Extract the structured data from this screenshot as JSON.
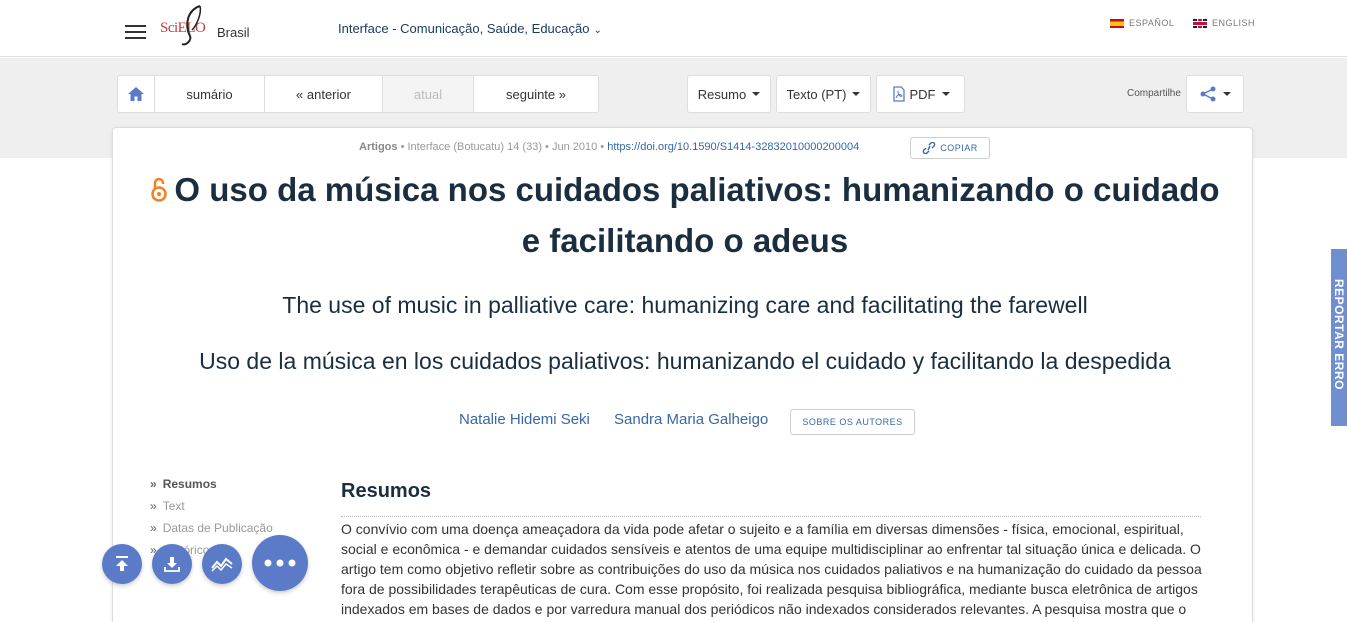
{
  "header": {
    "logo_brand": "SciELO",
    "logo_country": "Brasil",
    "journal": "Interface - Comunicação, Saúde, Educação",
    "languages": [
      {
        "code": "es",
        "label": "ESPAÑOL"
      },
      {
        "code": "en",
        "label": "ENGLISH"
      }
    ]
  },
  "toolbar": {
    "nav": {
      "sumario": "sumário",
      "anterior": "« anterior",
      "atual": "atual",
      "seguinte": "seguinte »"
    },
    "resumo": "Resumo",
    "texto": "Texto (PT)",
    "pdf": "PDF",
    "share_label": "Compartilhe"
  },
  "article": {
    "meta": {
      "category": "Artigos",
      "source": "Interface (Botucatu) 14 (33) • Jun 2010 •",
      "doi": "https://doi.org/10.1590/S1414-32832010000200004",
      "copy_label": "COPIAR"
    },
    "title": "O uso da música nos cuidados paliativos: humanizando o cuidado e facilitando o adeus",
    "title_en": "The use of music in palliative care: humanizing care and facilitating the farewell",
    "title_es": "Uso de la música en los cuidados paliativos: humanizando el cuidado y facilitando la despedida",
    "authors": [
      "Natalie Hidemi Seki",
      "Sandra Maria Galheigo"
    ],
    "about_authors_label": "SOBRE OS AUTORES"
  },
  "sidenav": {
    "items": [
      "Resumos",
      "Text",
      "Datas de Publicação",
      "Histórico"
    ]
  },
  "section": {
    "title": "Resumos",
    "abstract": "O convívio com uma doença ameaçadora da vida pode afetar o sujeito e a família em diversas dimensões - física, emocional, espiritual, social e econômica - e demandar cuidados sensíveis e atentos de uma equipe multidisciplinar ao enfrentar tal situação única e delicada. O artigo tem como objetivo refletir sobre as contribuições do uso da música nos cuidados paliativos e na humanização do cuidado da pessoa fora de possibilidades terapêuticas de cura. Com esse propósito, foi realizada pesquisa bibliográfica, mediante busca eletrônica de artigos indexados em bases de dados e por varredura manual dos periódicos não indexados considerados relevantes. A pesquisa mostra que o"
  },
  "report_tab": "REPORTAR ERRO",
  "colors": {
    "accent": "#3867a8",
    "fab": "#5b7bc8",
    "title": "#1a2e40",
    "open_access": "#f48120"
  },
  "icons": [
    "menu-icon",
    "home-icon",
    "pdf-icon",
    "share-icon",
    "link-icon",
    "open-access-icon",
    "arrow-up-icon",
    "download-icon",
    "metrics-icon",
    "more-icon"
  ]
}
